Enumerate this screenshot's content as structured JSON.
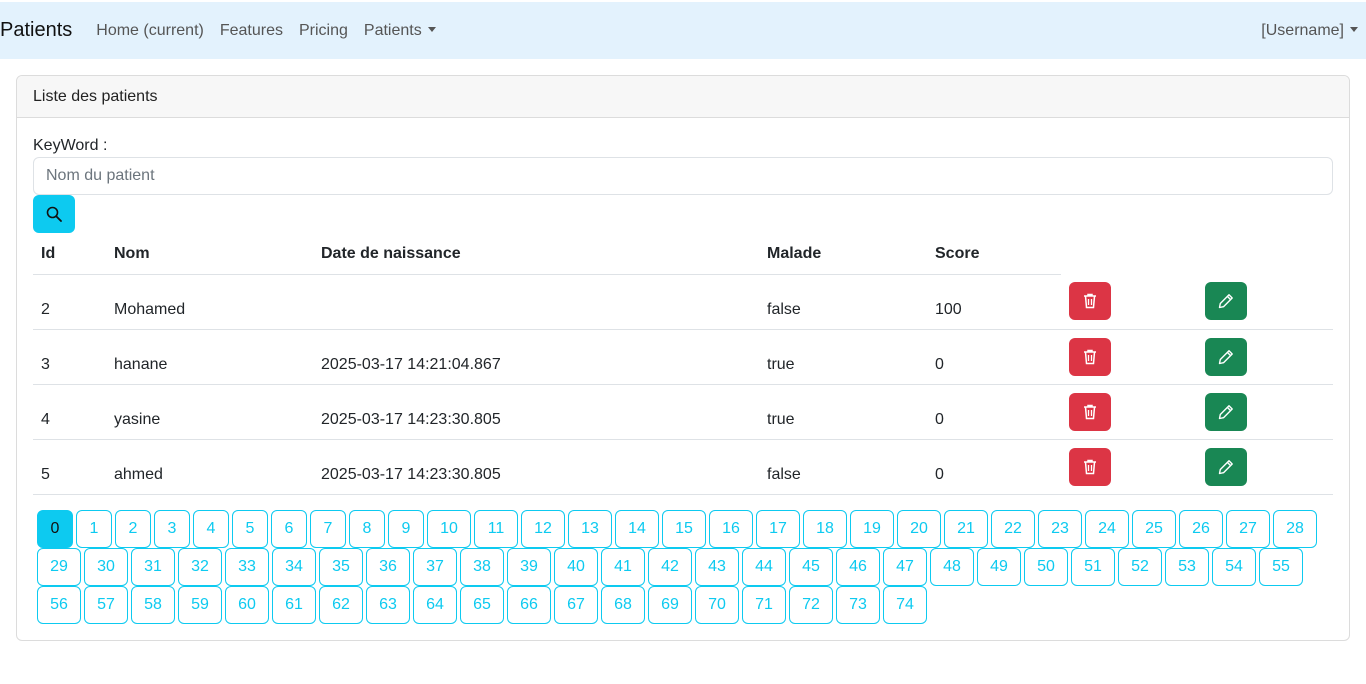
{
  "navbar": {
    "brand": "Patients",
    "links": [
      "Home (current)",
      "Features",
      "Pricing"
    ],
    "dropdown": "Patients",
    "user": "[Username]"
  },
  "card": {
    "header": "Liste des patients",
    "keyword_label": "KeyWord :",
    "keyword_placeholder": "Nom du patient"
  },
  "table": {
    "headers": [
      "Id",
      "Nom",
      "Date de naissance",
      "Malade",
      "Score"
    ],
    "rows": [
      {
        "id": "2",
        "nom": "Mohamed",
        "date": "",
        "malade": "false",
        "score": "100"
      },
      {
        "id": "3",
        "nom": "hanane",
        "date": "2025-03-17 14:21:04.867",
        "malade": "true",
        "score": "0"
      },
      {
        "id": "4",
        "nom": "yasine",
        "date": "2025-03-17 14:23:30.805",
        "malade": "true",
        "score": "0"
      },
      {
        "id": "5",
        "nom": "ahmed",
        "date": "2025-03-17 14:23:30.805",
        "malade": "false",
        "score": "0"
      }
    ]
  },
  "pagination": {
    "current": 0,
    "pages": [
      "0",
      "1",
      "2",
      "3",
      "4",
      "5",
      "6",
      "7",
      "8",
      "9",
      "10",
      "11",
      "12",
      "13",
      "14",
      "15",
      "16",
      "17",
      "18",
      "19",
      "20",
      "21",
      "22",
      "23",
      "24",
      "25",
      "26",
      "27",
      "28",
      "29",
      "30",
      "31",
      "32",
      "33",
      "34",
      "35",
      "36",
      "37",
      "38",
      "39",
      "40",
      "41",
      "42",
      "43",
      "44",
      "45",
      "46",
      "47",
      "48",
      "49",
      "50",
      "51",
      "52",
      "53",
      "54",
      "55",
      "56",
      "57",
      "58",
      "59",
      "60",
      "61",
      "62",
      "63",
      "64",
      "65",
      "66",
      "67",
      "68",
      "69",
      "70",
      "71",
      "72",
      "73",
      "74"
    ]
  },
  "colors": {
    "info": "#0dcaf0",
    "danger": "#dc3545",
    "success": "#198754",
    "navbar_bg": "#e3f2fd"
  },
  "icons": {
    "search": "search-icon",
    "delete": "trash-icon",
    "edit": "pencil-icon"
  }
}
